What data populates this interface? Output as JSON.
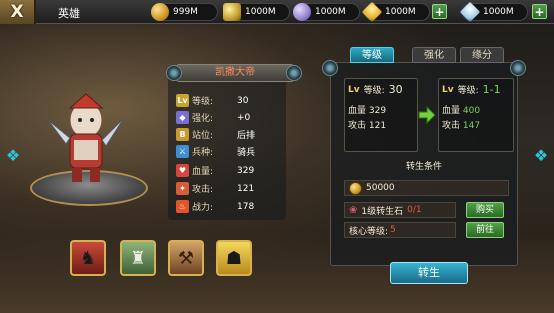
{
  "header": {
    "title": "英雄",
    "close_label": "X"
  },
  "resources": [
    {
      "name": "gold",
      "value": "999M",
      "icon": "gold-coin-icon",
      "color": "#e6b840"
    },
    {
      "name": "ore",
      "value": "1000M",
      "icon": "yellow-ore-icon",
      "color": "#e0c040"
    },
    {
      "name": "crystal",
      "value": "1000M",
      "icon": "purple-crystal-icon",
      "color": "#9b84c9"
    },
    {
      "name": "gem-yellow",
      "value": "1000M",
      "icon": "yellow-gem-icon",
      "color": "#f0c53a"
    },
    {
      "name": "diamond",
      "value": "1000M",
      "icon": "diamond-icon",
      "color": "#cfe7f7"
    }
  ],
  "plus_label": "+",
  "hero": {
    "name": "凯撒大帝",
    "stats": [
      {
        "key": "level",
        "icon_text": "Lv",
        "label": "等级:",
        "value": "30",
        "color": "#c7a42d"
      },
      {
        "key": "enhance",
        "icon_text": "◆",
        "label": "强化:",
        "value": "+0",
        "color": "#7a6fd0"
      },
      {
        "key": "position",
        "icon_text": "B",
        "label": "站位:",
        "value": "后排",
        "color": "#c99a2f"
      },
      {
        "key": "troop",
        "icon_text": "⚔",
        "label": "兵种:",
        "value": "骑兵",
        "color": "#3f8fd0"
      },
      {
        "key": "hp",
        "icon_text": "♥",
        "label": "血量:",
        "value": "329",
        "color": "#d8453a"
      },
      {
        "key": "attack",
        "icon_text": "✦",
        "label": "攻击:",
        "value": "121",
        "color": "#d95b3a"
      },
      {
        "key": "power",
        "icon_text": "♨",
        "label": "战力:",
        "value": "178",
        "color": "#e0552b"
      }
    ]
  },
  "skills": [
    {
      "name": "skill-red-beast",
      "glyph": "♞",
      "color": "#b8362f"
    },
    {
      "name": "skill-castle",
      "glyph": "♜",
      "color": "#5f8a54"
    },
    {
      "name": "skill-weapons",
      "glyph": "⚒",
      "color": "#9a6b3c"
    },
    {
      "name": "skill-shadow",
      "glyph": "☗",
      "color": "#e0b338"
    }
  ],
  "tabs": {
    "level": "等级",
    "enhance": "强化",
    "fate": "缘分"
  },
  "compare": {
    "current": {
      "lv_icon": "Lv",
      "label": "等级:",
      "value": "30",
      "hp_label": "血量",
      "hp": "329",
      "atk_label": "攻击",
      "atk": "121"
    },
    "next": {
      "lv_icon": "Lv",
      "label": "等级:",
      "value": "1-1",
      "hp_label": "血量",
      "hp": "400",
      "atk_label": "攻击",
      "atk": "147"
    }
  },
  "rebirth": {
    "title": "转生条件",
    "gold": "50000",
    "stone_label": "1级转生石",
    "stone_count": "0/1",
    "buy_label": "购买",
    "core_label": "核心等级:",
    "core_value": "5",
    "goto_label": "前往",
    "button_label": "转生"
  },
  "nav": {
    "left_arrow": "❖",
    "right_arrow": "❖"
  }
}
